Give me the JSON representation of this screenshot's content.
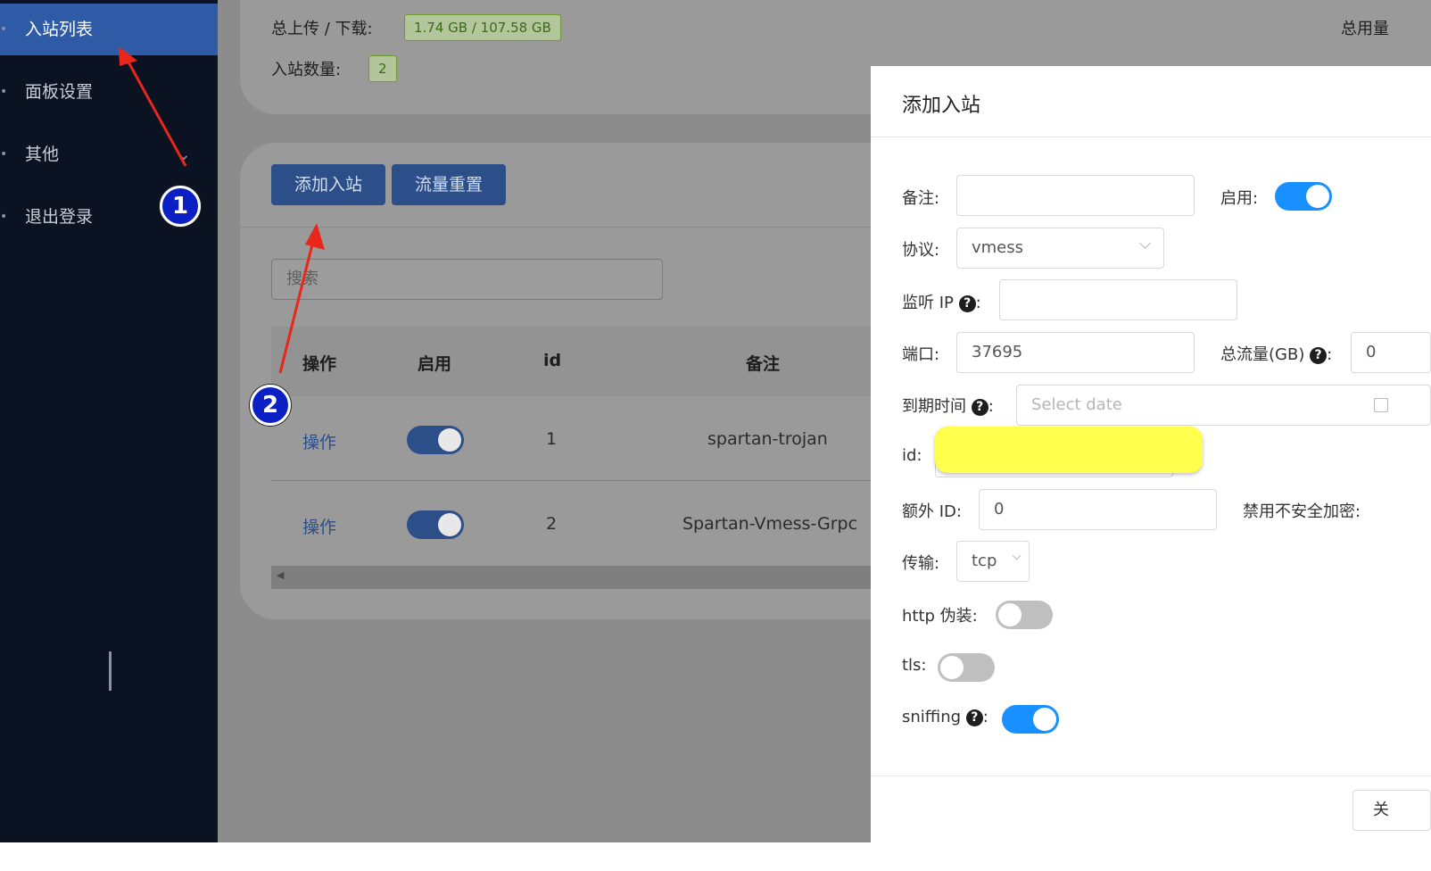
{
  "sidebar": {
    "items": [
      {
        "label": "入站列表",
        "icon": "list-icon",
        "active": true
      },
      {
        "label": "面板设置",
        "icon": "gear-icon",
        "active": false
      },
      {
        "label": "其他",
        "icon": "more-icon",
        "active": false
      },
      {
        "label": "退出登录",
        "icon": "logout-icon",
        "active": false
      }
    ],
    "chevron": "⌄"
  },
  "stats": {
    "traffic_label": "总上传 / 下载:",
    "traffic_value": "1.74 GB / 107.58 GB",
    "count_label": "入站数量:",
    "count_value": "2",
    "total_usage_label": "总用量"
  },
  "toolbar": {
    "add_label": "添加入站",
    "reset_label": "流量重置"
  },
  "search": {
    "placeholder": "搜索"
  },
  "table": {
    "headers": [
      "操作",
      "启用",
      "id",
      "备注"
    ],
    "rows": [
      {
        "action": "操作",
        "enabled": true,
        "id": "1",
        "remark": "spartan-trojan"
      },
      {
        "action": "操作",
        "enabled": true,
        "id": "2",
        "remark": "Spartan-Vmess-Grpc"
      }
    ],
    "scroll_left": "◀"
  },
  "modal": {
    "title": "添加入站",
    "remark_label": "备注:",
    "remark_value": "",
    "enable_label": "启用:",
    "enable_on": true,
    "protocol_label": "协议:",
    "protocol_value": "vmess",
    "listen_label": "监听 IP",
    "listen_value": "",
    "port_label": "端口:",
    "port_value": "37695",
    "total_traffic_label": "总流量(GB)",
    "total_traffic_value": "0",
    "expiry_label": "到期时间",
    "expiry_placeholder": "Select date",
    "id_label": "id:",
    "alter_id_label": "额外 ID:",
    "alter_id_value": "0",
    "disable_insecure_label": "禁用不安全加密:",
    "transport_label": "传输:",
    "transport_value": "tcp",
    "http_label": "http 伪装:",
    "http_on": false,
    "tls_label": "tls:",
    "tls_on": false,
    "sniffing_label": "sniffing",
    "sniffing_on": true,
    "close_label": "关",
    "colon": ":",
    "qmark": "?"
  },
  "annotations": {
    "step1": "1",
    "step2": "2"
  },
  "colors": {
    "sidebar_bg": "#0b1322",
    "active": "#2f5aa6",
    "primary": "#1890ff",
    "arrow": "#e8261c",
    "highlight": "#ffff4d"
  }
}
